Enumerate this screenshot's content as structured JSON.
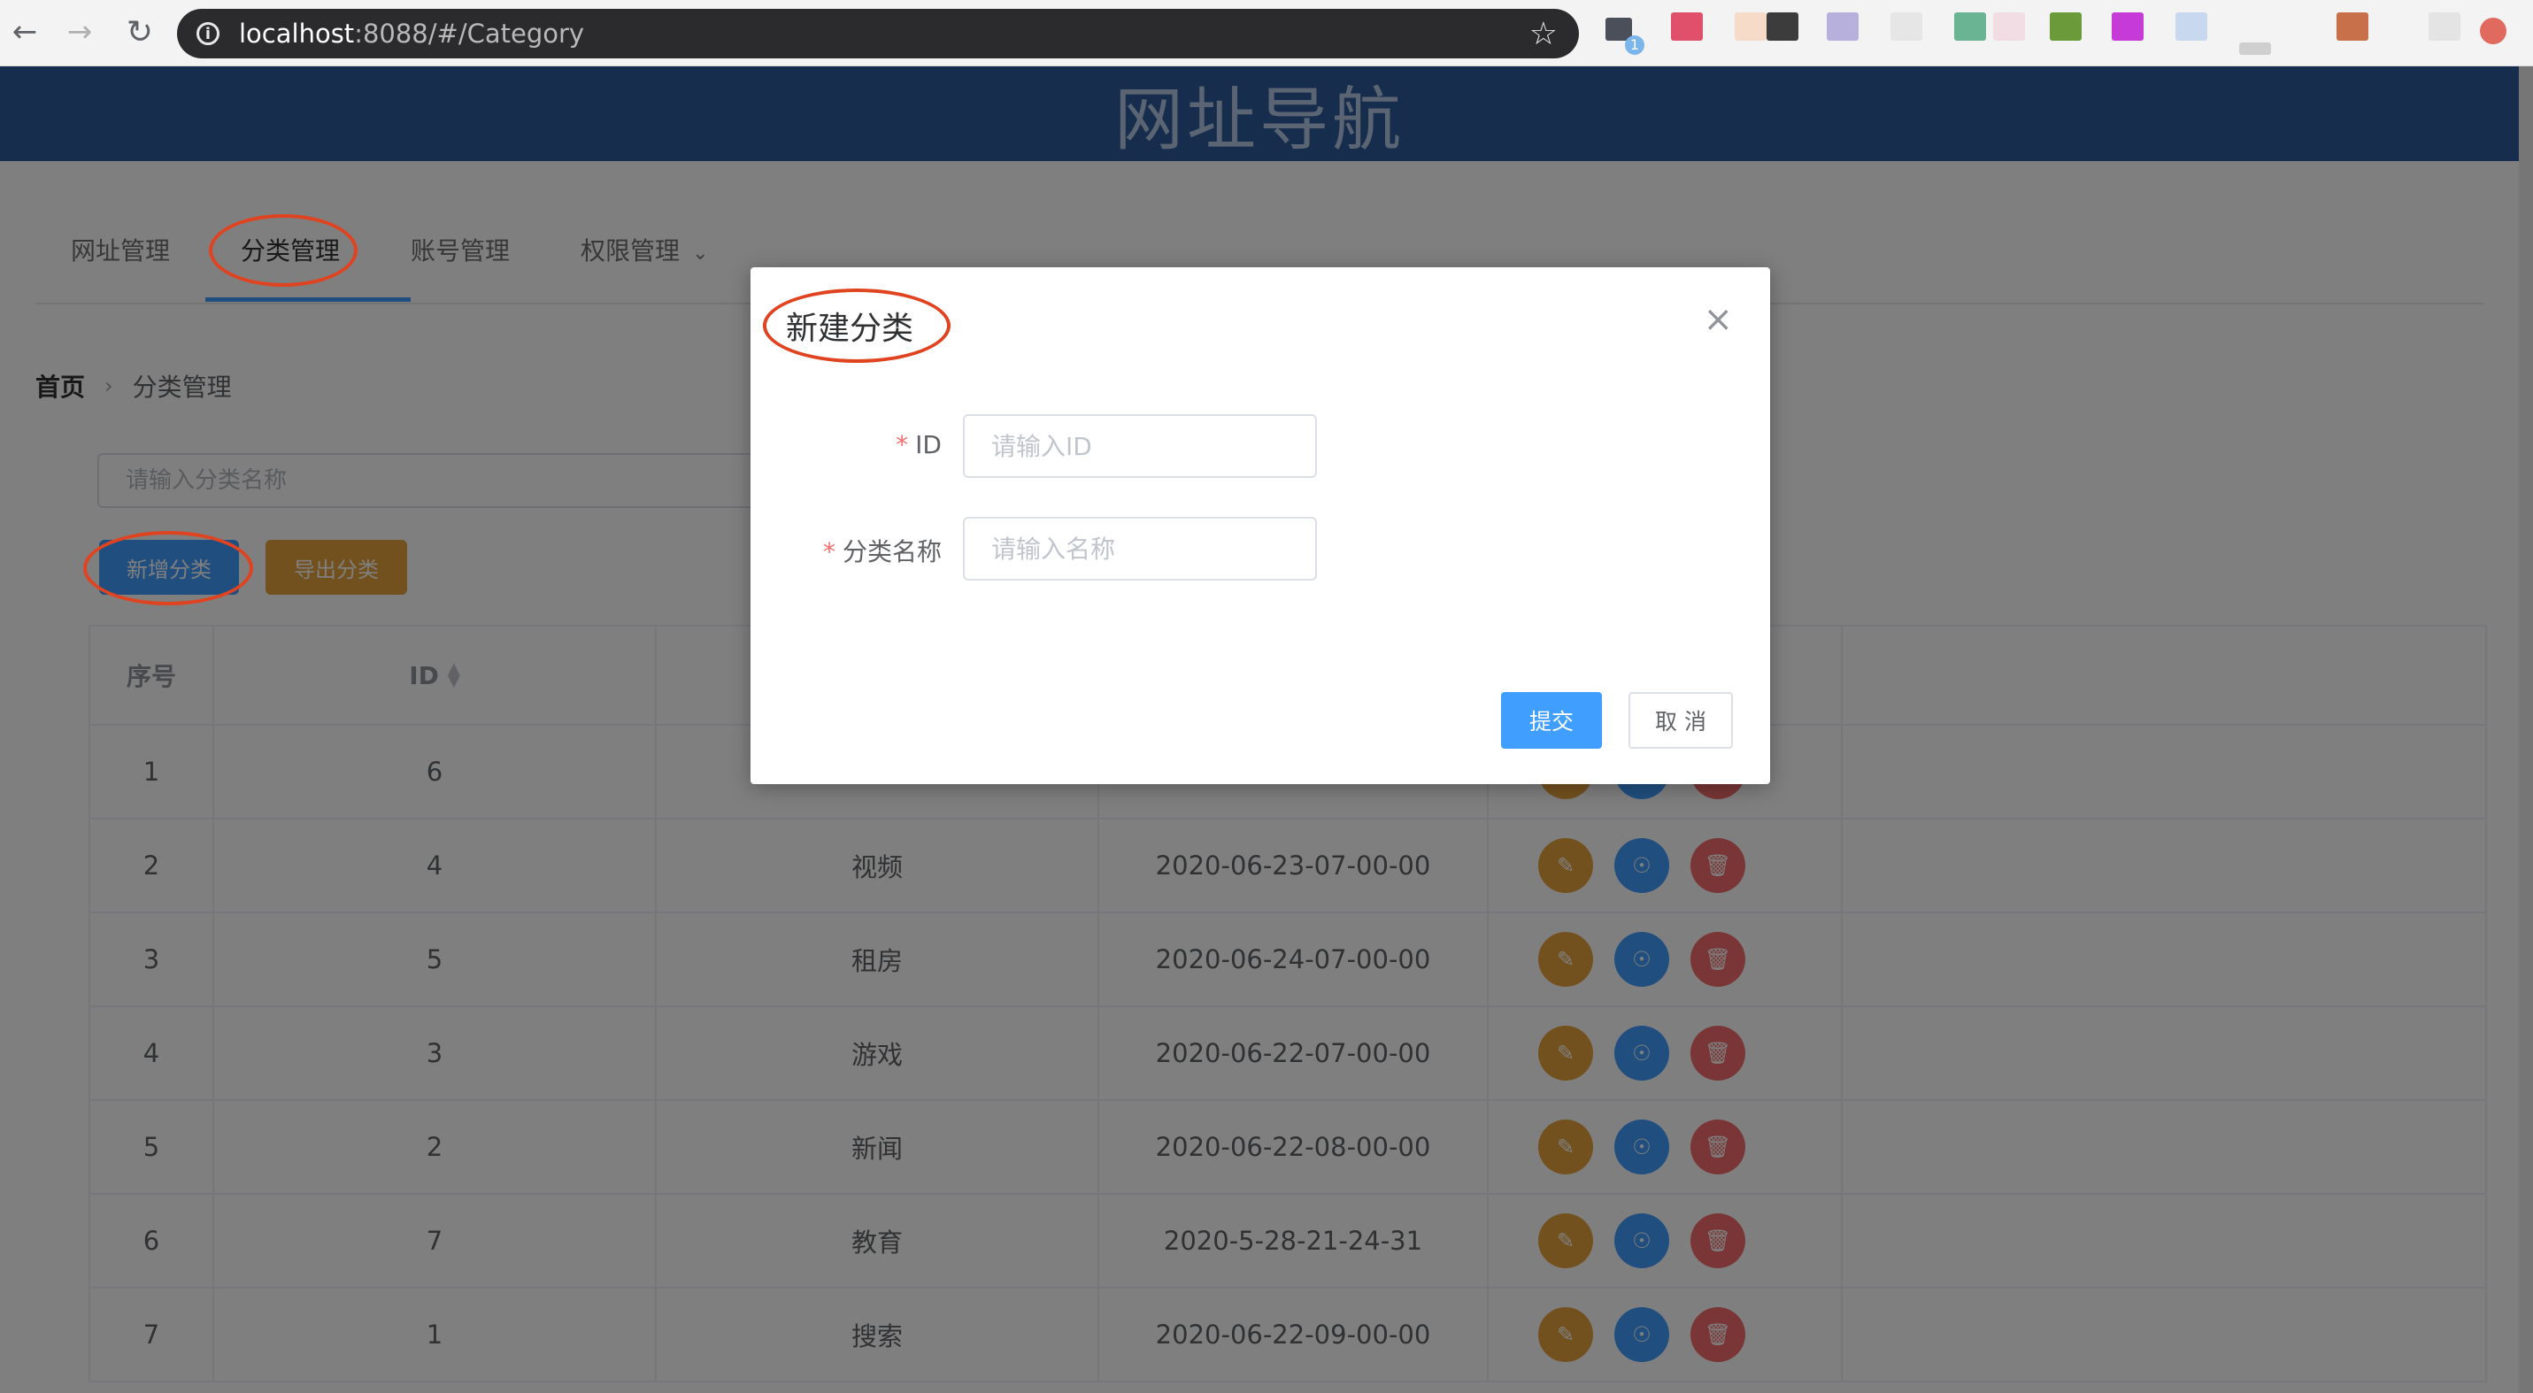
{
  "browser": {
    "url_host": "localhost",
    "url_path": ":8088/#/Category",
    "extension_badge": "1"
  },
  "site": {
    "title": "网址导航"
  },
  "tabs": [
    {
      "label": "网址管理"
    },
    {
      "label": "分类管理"
    },
    {
      "label": "账号管理"
    },
    {
      "label": "权限管理"
    }
  ],
  "breadcrumb": {
    "home": "首页",
    "current": "分类管理"
  },
  "search": {
    "placeholder": "请输入分类名称"
  },
  "toolbar": {
    "add_label": "新增分类",
    "export_label": "导出分类"
  },
  "table": {
    "headers": {
      "index": "序号",
      "id": "ID"
    },
    "rows": [
      {
        "index": "1",
        "id": "6",
        "name": "",
        "time": ""
      },
      {
        "index": "2",
        "id": "4",
        "name": "视频",
        "time": "2020-06-23-07-00-00"
      },
      {
        "index": "3",
        "id": "5",
        "name": "租房",
        "time": "2020-06-24-07-00-00"
      },
      {
        "index": "4",
        "id": "3",
        "name": "游戏",
        "time": "2020-06-22-07-00-00"
      },
      {
        "index": "5",
        "id": "2",
        "name": "新闻",
        "time": "2020-06-22-08-00-00"
      },
      {
        "index": "6",
        "id": "7",
        "name": "教育",
        "time": "2020-5-28-21-24-31"
      },
      {
        "index": "7",
        "id": "1",
        "name": "搜索",
        "time": "2020-06-22-09-00-00"
      }
    ]
  },
  "dialog": {
    "title": "新建分类",
    "fields": {
      "id": {
        "label": "ID",
        "placeholder": "请输入ID"
      },
      "name": {
        "label": "分类名称",
        "placeholder": "请输入名称"
      }
    },
    "submit_label": "提交",
    "cancel_label": "取 消"
  }
}
